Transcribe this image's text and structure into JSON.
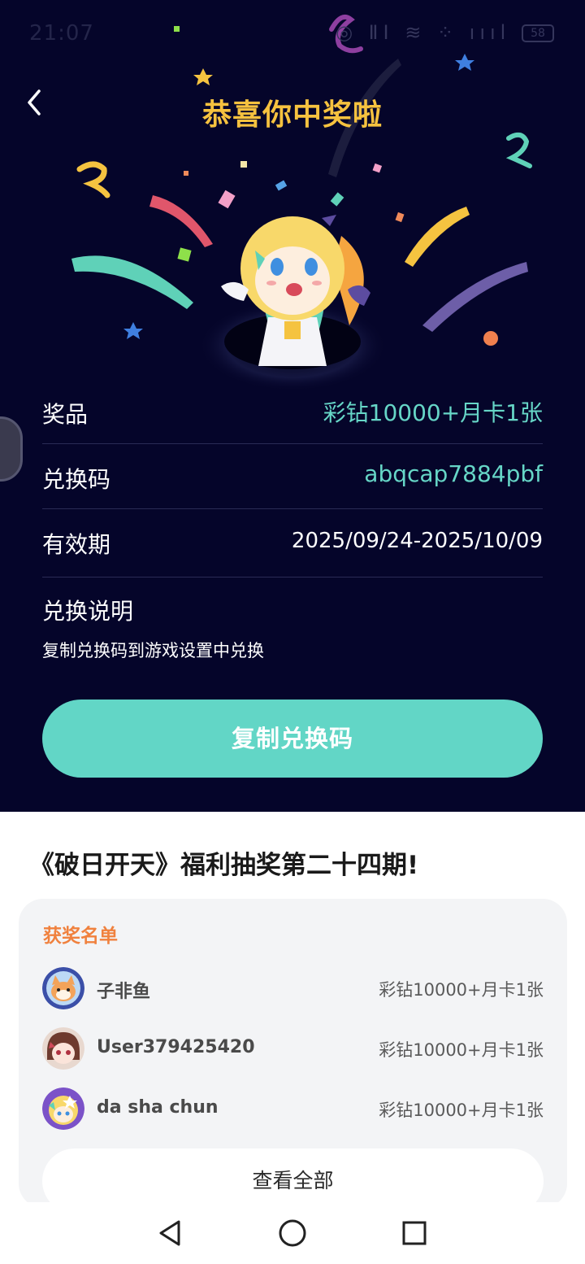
{
  "status_bar": {
    "time": "21:07",
    "icons_text": "◎ ⅡⅠ ≋ ⁘ ıııl",
    "battery": "58"
  },
  "header": {
    "title": "恭喜你中奖啦"
  },
  "prize_info": {
    "prize_label": "奖品",
    "prize_value": "彩钻10000+月卡1张",
    "code_label": "兑换码",
    "code_value": "abqcap7884pbf",
    "validity_label": "有效期",
    "validity_value": "2025/09/24-2025/10/09",
    "instructions_title": "兑换说明",
    "instructions_text": "复制兑换码到游戏设置中兑换"
  },
  "copy_button_label": "复制兑换码",
  "event": {
    "title": "《破日开天》福利抽奖第二十四期!",
    "winners_title": "获奖名单",
    "winners": [
      {
        "name": "子非鱼",
        "prize": "彩钻10000+月卡1张"
      },
      {
        "name": "User379425420",
        "prize": "彩钻10000+月卡1张"
      },
      {
        "name": "da sha chun",
        "prize": "彩钻10000+月卡1张"
      }
    ],
    "view_all_label": "查看全部"
  },
  "colors": {
    "background_dark": "#05052a",
    "title_gold": "#f6c23f",
    "accent_teal": "#62d6c6",
    "winners_orange": "#f0813e"
  },
  "icons": {
    "back": "chevron-left-icon",
    "nav_back": "triangle-back-icon",
    "nav_home": "circle-home-icon",
    "nav_recents": "square-recents-icon"
  }
}
